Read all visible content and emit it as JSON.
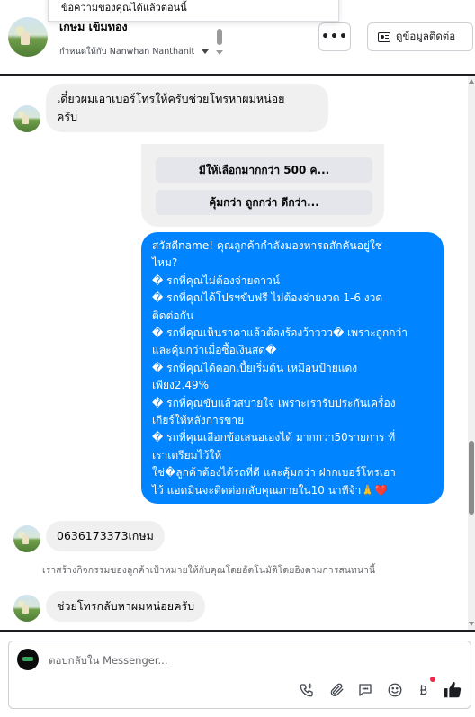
{
  "toast": {
    "text": "ข้อความของคุณได้แล้วตอนนี้"
  },
  "header": {
    "contact_name": "เกษม เข็มทอง",
    "assigned_label": "กำหนดให้กับ Nanwhan Nanthanit",
    "more_label": "•••",
    "contact_info_label": "ดูข้อมูลติดต่อ"
  },
  "messages": {
    "m1": {
      "line1": "เดี๋ยวผมเอาเบอร์โทรให้ครับช่วยโทรหาผมหน่อย",
      "line2": "ครับ"
    },
    "card": {
      "button1": "มีให้เลือกมากกว่า 500 ค...",
      "button2": "คุ้มกว่า ถูกกว่า ดีกว่า..."
    },
    "outgoing": "สวัสดีname! คุณลูกค้ากำลังมองหารถสักคันอยู่ใช่\nไหม?\n� รถที่คุณไม่ต้องจ่ายดาวน์\n� รถที่คุณได้โปรฯขับฟรี ไม่ต้องจ่ายงวด 1-6 งวด\nติดต่อกัน\n� รถที่คุณเห็นราคาแล้วต้องร้องว้าววว� เพราะถูกกว่า\nและคุ้มกว่าเมื่อซื้อเงินสด�\n� รถที่คุณได้ดอกเบี้ยเริ่มต้น เหมือนป้ายแดง\nเพียง2.49%\n� รถที่คุณขับแล้วสบายใจ เพราะเรารับประกันเครื่อง\nเกียร์ให้หลังการขาย\n� รถที่คุณเลือกข้อเสนอเองได้ มากกว่า50รายการ ที่\nเราเตรียมไว้ให้\nใช่�ลูกค้าต้องได้รถที่ดี และคุ้มกว่า ฝากเบอร์โทรเอา\nไว้ แอดมินจะติดต่อกลับคุณภายใน10 นาทีจ้า🙏❤️",
    "m3": "0636173373เกษม",
    "system_note": "เราสร้างกิจกรรมของลูกค้าเป้าหมายให้กับคุณโดยอัตโนมัติโดยอิงตามการสนทนานี้",
    "m4": "ช่วยโทรกลับหาผมหน่อยครับ"
  },
  "composer": {
    "placeholder": "ตอบกลับใน Messenger...",
    "tools": [
      "add-call-icon",
      "attachment-icon",
      "saved-reply-icon",
      "emoji-icon",
      "payment-icon",
      "like-icon"
    ]
  },
  "colors": {
    "accent": "#0084ff",
    "incoming_bubble": "#f0f0f0",
    "notification": "#f02849"
  }
}
